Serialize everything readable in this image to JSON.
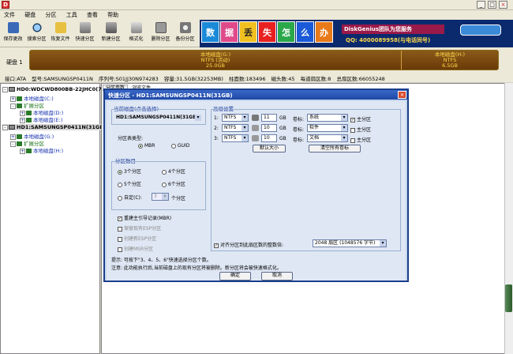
{
  "app": {
    "title": "",
    "icon_text": "D"
  },
  "window_controls": [
    "_",
    "□",
    "×"
  ],
  "menu": [
    "文件",
    "硬盘",
    "分区",
    "工具",
    "查看",
    "帮助"
  ],
  "toolbar": [
    "保存更改",
    "搜索分区",
    "恢复文件",
    "快速分区",
    "新建分区",
    "格式化",
    "删除分区",
    "备份分区"
  ],
  "banner": {
    "chars": [
      "数",
      "据",
      "丢",
      "失",
      "怎",
      "么",
      "办"
    ],
    "brand": "DiskGenius团队为您服务",
    "qq": "QQ: 4000089958(与电话同号)"
  },
  "disk": {
    "label": "硬盘 1",
    "part1": {
      "name": "本地磁盘(G:)",
      "fs": "NTFS (活动)",
      "size": "25.0GB"
    },
    "part2": {
      "name": "本地磁盘(H:)",
      "fs": "NTFS",
      "size": "6.5GB"
    },
    "info": [
      "接口:ATA",
      "型号:SAMSUNGSP0411N",
      "序列号:S01JJ30N974283",
      "容量:31.5GB(32253MB)",
      "柱面数:183496",
      "磁头数:45",
      "每道扇区数:8",
      "总扇区数:66055248"
    ]
  },
  "tree": [
    {
      "text": "HD0:WDCWD800BB-22JHC0(75G)",
      "level": 0
    },
    {
      "text": "本地磁盘(C:)",
      "level": 1
    },
    {
      "text": "扩展分区",
      "level": 1
    },
    {
      "text": "本地磁盘(D:)",
      "level": 2
    },
    {
      "text": "本地磁盘(E:)",
      "level": 2
    },
    {
      "text": "HD1:SAMSUNGSP0411N(31GB)",
      "level": 0
    },
    {
      "text": "本地磁盘(G:)",
      "level": 1
    },
    {
      "text": "扩展分区",
      "level": 1
    },
    {
      "text": "本地磁盘(H:)",
      "level": 2
    }
  ],
  "right_tabs": [
    "分区参数",
    "浏览文件"
  ],
  "dialog": {
    "title": "快速分区 - HD1:SAMSUNGSP0411N(31GB)",
    "current_disk_label": "当前磁盘(点击选择)",
    "current_disk_value": "HD1:SAMSUNGSP0411N(31GB)",
    "table_type_label": "分区表类型:",
    "table_types": [
      "MBR",
      "GUID"
    ],
    "count_label": "分区数目",
    "counts": [
      "3个分区",
      "4个分区",
      "5个分区",
      "6个分区"
    ],
    "custom_label": "自定(C):",
    "custom_value": "3",
    "custom_suffix": "个分区",
    "mbr_check": "重建主引导记录(MBR)",
    "esp_check": "保留现有ESP分区",
    "new_esp_check": "创建新ESP分区",
    "msr_check": "创建MSR分区",
    "advanced_label": "高级设置",
    "rows": [
      {
        "num": "1:",
        "fs": "NTFS",
        "size": "11",
        "unit": "GB",
        "vol_label": "卷标:",
        "vol": "系统",
        "primary": "主分区"
      },
      {
        "num": "2:",
        "fs": "NTFS",
        "size": "10",
        "unit": "GB",
        "vol_label": "卷标:",
        "vol": "软件",
        "primary": "主分区"
      },
      {
        "num": "3:",
        "fs": "NTFS",
        "size": "10",
        "unit": "GB",
        "vol_label": "卷标:",
        "vol": "文档",
        "primary": "主分区"
      }
    ],
    "default_size_btn": "默认大小",
    "clear_labels_btn": "清空所有卷标",
    "align_label": "对齐分区到此扇区数的整数倍:",
    "align_value": "2048 扇区 (1048576 字节)",
    "hint1": "提示: 可按下\"3、4、5、6\"快速选择分区个数。",
    "hint2": "注意: 此功能执行后,当前磁盘上的现有分区将被删除。新分区将会被快速格式化。",
    "ok": "确定",
    "cancel": "取消"
  },
  "colors": {
    "dialog_border": "#1a3f8a",
    "title_bar": "#2a55b8",
    "partition": "#7a4a10",
    "partition_text": "#ffd84a"
  }
}
